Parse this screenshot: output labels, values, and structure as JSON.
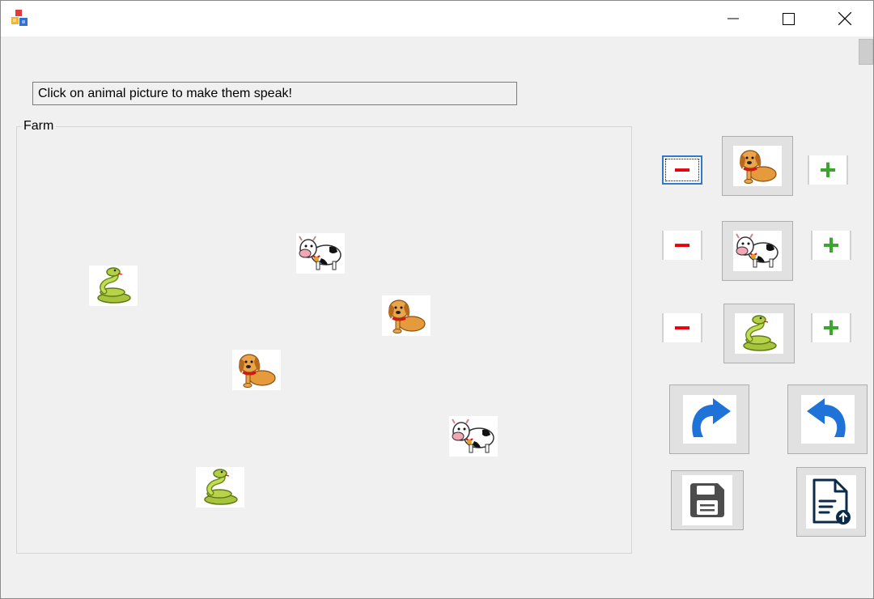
{
  "window": {
    "minimize_glyph": "minimize-icon",
    "maximize_glyph": "maximize-icon",
    "close_glyph": "close-icon"
  },
  "hint_text": "Click on animal picture to make them speak!",
  "farm": {
    "legend": "Farm",
    "animals": [
      {
        "kind": "snake",
        "icon": "snake-icon"
      },
      {
        "kind": "cow",
        "icon": "cow-icon"
      },
      {
        "kind": "dog",
        "icon": "dog-icon"
      },
      {
        "kind": "dog",
        "icon": "dog-icon"
      },
      {
        "kind": "cow",
        "icon": "cow-icon"
      },
      {
        "kind": "snake",
        "icon": "snake-icon"
      }
    ]
  },
  "controls": {
    "rows": [
      {
        "animal": "dog",
        "minus": "−",
        "plus": "+"
      },
      {
        "animal": "cow",
        "minus": "−",
        "plus": "+"
      },
      {
        "animal": "snake",
        "minus": "−",
        "plus": "+"
      }
    ],
    "redo_icon": "redo-icon",
    "undo_icon": "undo-icon",
    "save_icon": "save-icon",
    "load_icon": "file-upload-icon"
  },
  "colors": {
    "minus": "#e8000a",
    "plus": "#3aa62e",
    "arrow_blue": "#1f73d8",
    "save_gray": "#4d4d4d",
    "file_navy": "#0c2b4a"
  }
}
